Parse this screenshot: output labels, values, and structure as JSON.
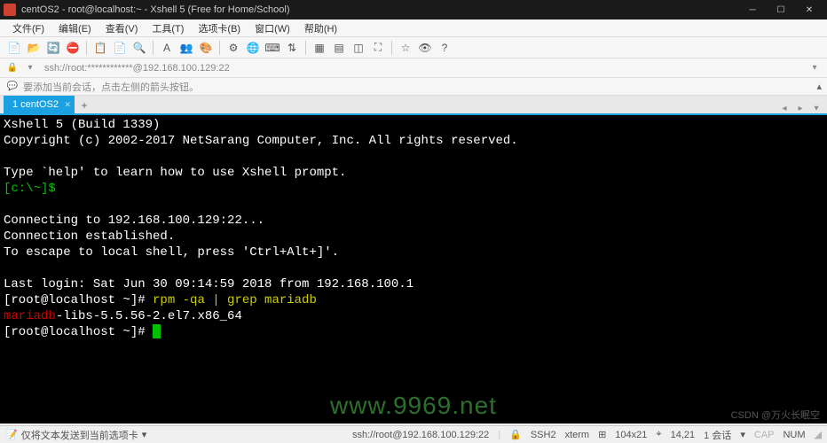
{
  "titlebar": {
    "text": "centOS2 - root@localhost:~ - Xshell 5 (Free for Home/School)"
  },
  "menu": {
    "file": "文件(F)",
    "edit": "编辑(E)",
    "view": "查看(V)",
    "tools": "工具(T)",
    "tabs": "选项卡(B)",
    "window": "窗口(W)",
    "help": "帮助(H)"
  },
  "address": {
    "text": "ssh://root:************@192.168.100.129:22"
  },
  "hint": {
    "text": "要添加当前会话，点击左侧的箭头按钮。"
  },
  "tab": {
    "label": "1 centOS2"
  },
  "terminal": {
    "l1": "Xshell 5 (Build 1339)",
    "l2": "Copyright (c) 2002-2017 NetSarang Computer, Inc. All rights reserved.",
    "l3": "Type `help' to learn how to use Xshell prompt.",
    "prompt1": "[c:\\~]$",
    "l5": "Connecting to 192.168.100.129:22...",
    "l6": "Connection established.",
    "l7": "To escape to local shell, press 'Ctrl+Alt+]'.",
    "l8": "Last login: Sat Jun 30 09:14:59 2018 from 192.168.100.1",
    "cmd1_prompt": "[root@localhost ~]# ",
    "cmd1": "rpm -qa | grep mariadb",
    "result_red": "mariadb",
    "result_rest": "-libs-5.5.56-2.el7.x86_64",
    "cmd2_prompt": "[root@localhost ~]# "
  },
  "status": {
    "left_hint": "仅将文本发送到当前选项卡",
    "conn": "ssh://root@192.168.100.129:22",
    "ssh": "SSH2",
    "term": "xterm",
    "size": "104x21",
    "pos": "14,21",
    "session": "1 会话",
    "cap": "CAP",
    "num": "NUM"
  },
  "watermark": "www.9969.net",
  "csdn": "CSDN @万火长眠空"
}
